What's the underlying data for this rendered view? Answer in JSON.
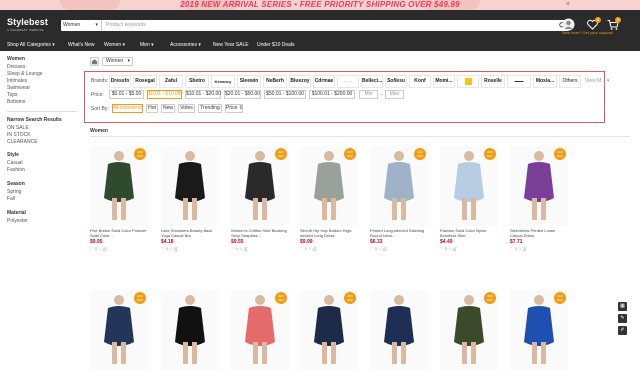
{
  "promo": {
    "text": "2019 NEW ARRIVAL SERIES • FREE PRIORITY SHIPPING OVER $49.99",
    "close": "×"
  },
  "header": {
    "logo": "Stylebest",
    "logo_sub": "A GEARBEST WEBSITE",
    "search_category": "Women",
    "search_placeholder": "Product keywords",
    "cart_badge": "0",
    "wish_badge": "0",
    "signin_text": "New here? Get your coupon!"
  },
  "nav": [
    "Shop All Categories",
    "What's New",
    "Women",
    "Men",
    "Accessories",
    "New Year SALE",
    "Under $10 Deals"
  ],
  "sidebar": {
    "women_title": "Women",
    "women_items": [
      "Dresses",
      "Sleep & Lounge",
      "Intimates",
      "Swimwear",
      "Tops",
      "Bottoms"
    ],
    "narrow_title": "Narrow Search Results",
    "narrow_items": [
      "ON SALE",
      "IN STOCK",
      "CLEARANCE"
    ],
    "style_title": "Style",
    "style_items": [
      "Casual",
      "Fashion"
    ],
    "season_title": "Season",
    "season_items": [
      "Spring",
      "Fall"
    ],
    "material_title": "Material",
    "material_items": [
      "Polyester"
    ]
  },
  "breadcrumb": {
    "current": "Women"
  },
  "filters": {
    "brands_label": "Brands:",
    "brands": [
      "Dressfo",
      "Rosegal",
      "Zaful",
      "Sbetro",
      "Kenancy",
      "Sleewin",
      "NeBerh",
      "Bluezoy",
      "Cdrmae",
      "",
      "Belleci...",
      "Sofiesu",
      "Konf",
      "Momi...",
      "",
      "Roselle",
      "",
      "Moxia...",
      "Others"
    ],
    "view_more": "View M...",
    "price_label": "Price:",
    "prices": [
      "$0.01 - $5.00",
      "$5.01 - $10.00",
      "$10.01 - $20.00",
      "$20.01 - $50.00",
      "$50.01 - $100.00",
      "$100.01 - $200.00"
    ],
    "min": "Min",
    "max": "Max",
    "sort_label": "Sort By:",
    "sorts": [
      "Recommend",
      "Hot",
      "New",
      "Votes",
      "Trending",
      "Price"
    ]
  },
  "section_title": "Women",
  "products": [
    {
      "name": "Five Button Solid Color Pullover Solid Color ...",
      "price": "$9.95",
      "off": "45% OFF",
      "color": "#2f4a2f"
    },
    {
      "name": "Lace Shoulders Beauty Back Yoga Casual Bra",
      "price": "$4.18",
      "off": "",
      "color": "#1a1a1a"
    },
    {
      "name": "Women's Chiffon Shirt Blocking Sexy Strapless...",
      "price": "$9.55",
      "off": "49% OFF",
      "color": "#2a2a2a"
    },
    {
      "name": "Slim-fit Hip Hop Bottom High-necked Long Dress",
      "price": "$9.99",
      "off": "47% OFF",
      "color": "#9aa09a"
    },
    {
      "name": "Printed Long-sleeved Stitching Round Neck...",
      "price": "$6.33",
      "off": "41% OFF",
      "color": "#9fb3c8"
    },
    {
      "name": "Fashion Solid Color Nylon Boneless Skirt",
      "price": "$4.49",
      "off": "22% OFF",
      "color": "#b7cde3"
    },
    {
      "name": "Sleeveless Printed Loose Casual Dress",
      "price": "$7.71",
      "off": "41% OFF",
      "color": "#7b3f9a"
    },
    {
      "name": "",
      "price": "",
      "off": "40% OFF",
      "color": "#23365a"
    },
    {
      "name": "",
      "price": "",
      "off": "",
      "color": "#111111"
    },
    {
      "name": "",
      "price": "",
      "off": "40% OFF",
      "color": "#e56b6b"
    },
    {
      "name": "",
      "price": "",
      "off": "40% OFF",
      "color": "#1e2a4a"
    },
    {
      "name": "",
      "price": "",
      "off": "",
      "color": "#1d2f55"
    },
    {
      "name": "",
      "price": "",
      "off": "40% OFF",
      "color": "#3b4a2a"
    },
    {
      "name": "",
      "price": "",
      "off": "41% OFF",
      "color": "#1f4fb0"
    }
  ],
  "actions": "♡ 0  ☆  🛒"
}
